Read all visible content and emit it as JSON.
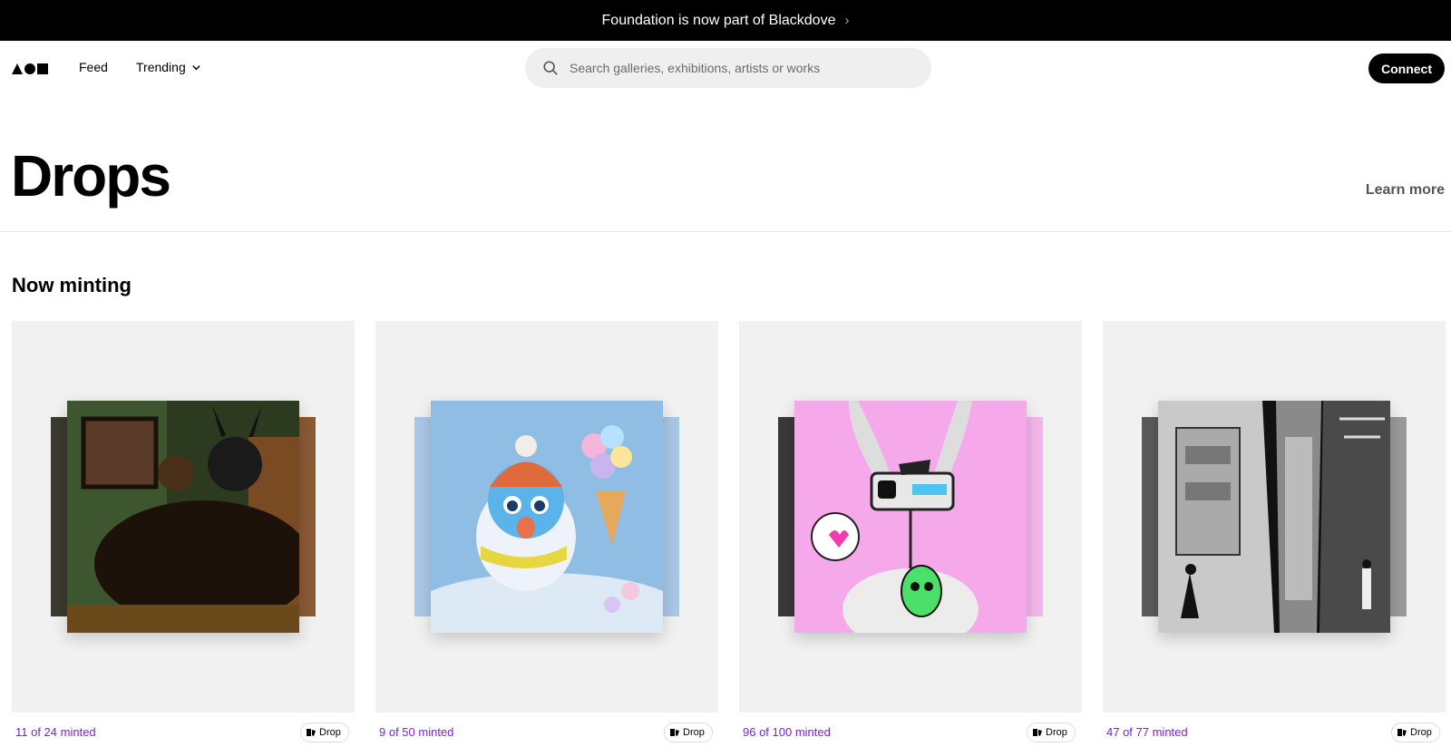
{
  "banner": {
    "text": "Foundation is now part of Blackdove",
    "chevron": "›"
  },
  "header": {
    "logo": "foundation-logo",
    "nav": {
      "feed": "Feed",
      "trending": "Trending"
    },
    "search_placeholder": "Search galleries, exhibitions, artists or works",
    "connect_label": "Connect"
  },
  "page": {
    "title": "Drops",
    "learn_more": "Learn more"
  },
  "section": {
    "title": "Now minting"
  },
  "cards": [
    {
      "minted": "11 of 24 minted",
      "badge": "Drop"
    },
    {
      "minted": "9 of 50 minted",
      "badge": "Drop"
    },
    {
      "minted": "96 of 100 minted",
      "badge": "Drop"
    },
    {
      "minted": "47 of 77 minted",
      "badge": "Drop"
    }
  ],
  "colors": {
    "minted_text": "#7a1fe0",
    "card_bg": "#f1f1f1",
    "banner_bg": "#000000"
  }
}
